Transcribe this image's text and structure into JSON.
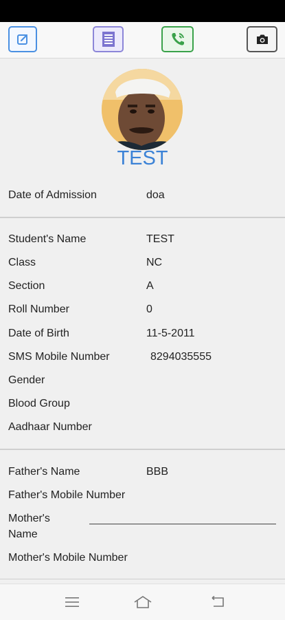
{
  "toolbar": {
    "buttons": [
      {
        "icon": "edit-icon",
        "color": "#4a90e2"
      },
      {
        "icon": "document-icon",
        "color": "#8c86d8"
      },
      {
        "icon": "phone-call-icon",
        "color": "#3aa24a"
      },
      {
        "icon": "camera-icon",
        "color": "#555555"
      }
    ]
  },
  "profile": {
    "name": "TEST",
    "name_color": "#3b82d6"
  },
  "admission": {
    "label": "Date of Admission",
    "value": "doa"
  },
  "student": {
    "name_label": "Student's Name",
    "name_value": "TEST",
    "class_label": "Class",
    "class_value": "NC",
    "section_label": "Section",
    "section_value": "A",
    "roll_label": "Roll Number",
    "roll_value": "0",
    "dob_label": "Date of Birth",
    "dob_value": "11-5-2011",
    "sms_label": "SMS Mobile Number",
    "sms_value": "8294035555",
    "gender_label": "Gender",
    "blood_label": "Blood Group",
    "aadhaar_label": "Aadhaar Number"
  },
  "parents": {
    "father_name_label": "Father's Name",
    "father_name_value": "BBB",
    "father_mobile_label": "Father's Mobile Number",
    "mother_name_label_1": "Mother's",
    "mother_name_label_2": "Name",
    "mother_mobile_label": "Mother's Mobile Number"
  },
  "navbar": {
    "icons": [
      "menu-icon",
      "home-icon",
      "back-icon"
    ]
  }
}
